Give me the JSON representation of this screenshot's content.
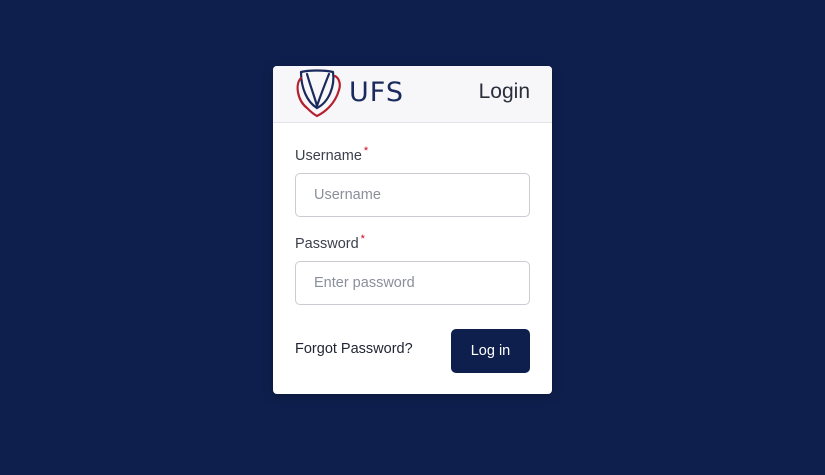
{
  "brand": {
    "name": "UFS",
    "icon": "ufs-shield-logo-icon",
    "colors": {
      "primary": "#0f1f4d",
      "accent": "#b5202e"
    }
  },
  "header": {
    "title": "Login"
  },
  "form": {
    "username": {
      "label": "Username",
      "required_mark": "*",
      "placeholder": "Username",
      "value": ""
    },
    "password": {
      "label": "Password",
      "required_mark": "*",
      "placeholder": "Enter password",
      "value": ""
    },
    "forgot_label": "Forgot Password?",
    "submit_label": "Log in"
  }
}
